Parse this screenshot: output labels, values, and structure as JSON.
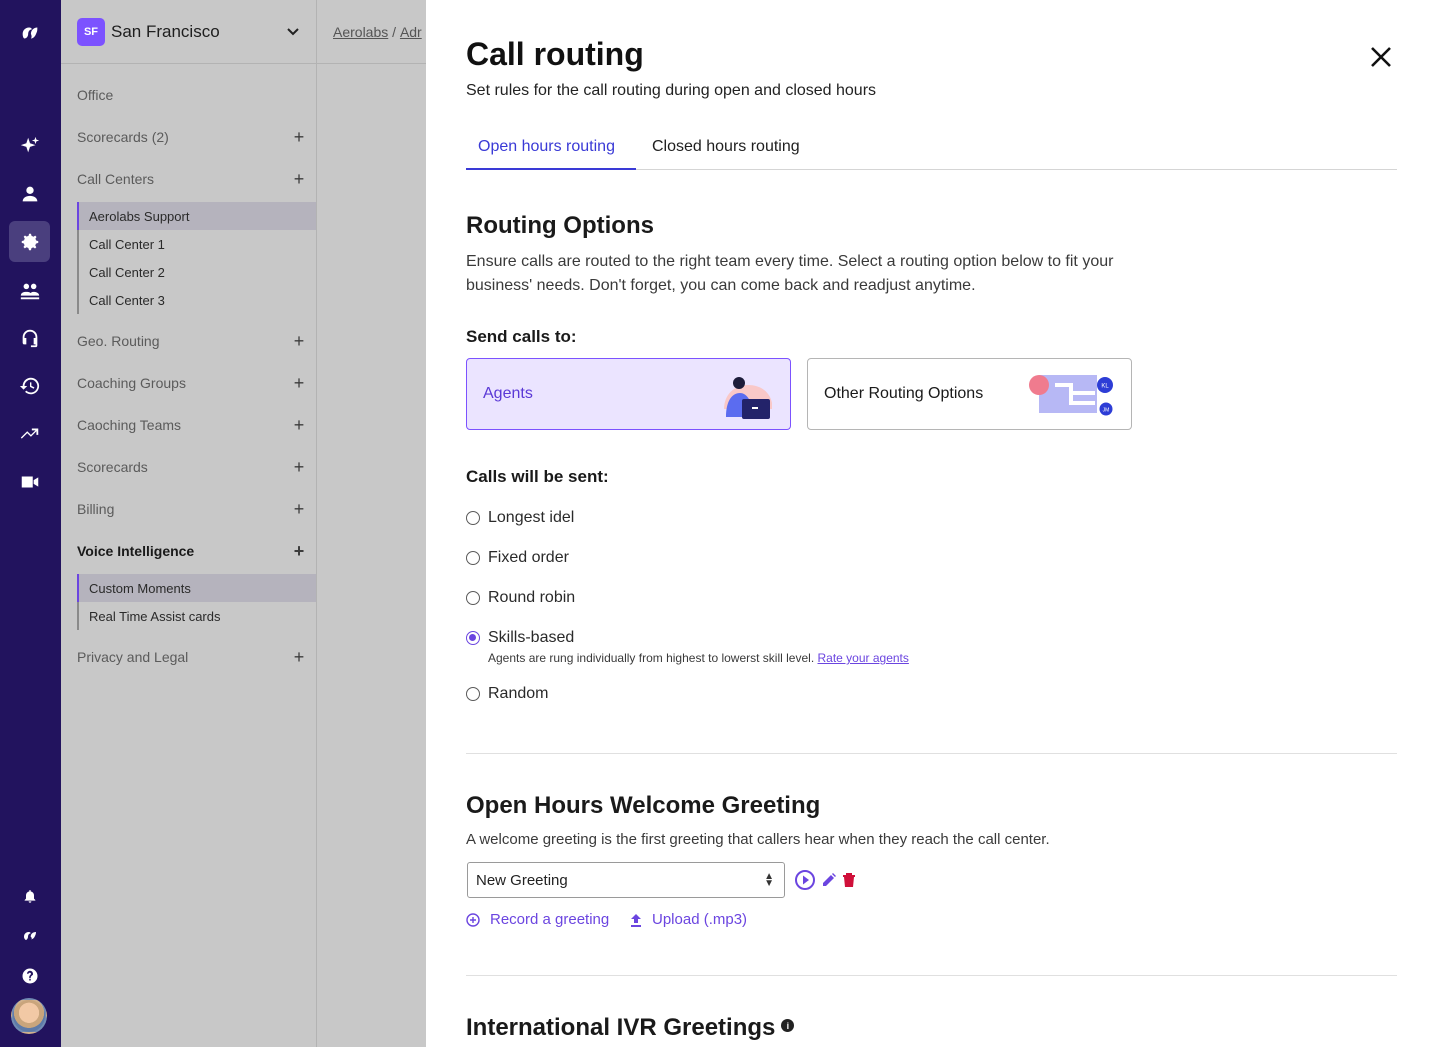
{
  "sidebar": {
    "location_badge": "SF",
    "location_name": "San Francisco",
    "items": [
      {
        "label": "Office"
      },
      {
        "label": "Scorecards (2)",
        "plus": "+"
      },
      {
        "label": "Call Centers",
        "plus": "+"
      },
      {
        "label": "Geo. Routing",
        "plus": "+"
      },
      {
        "label": "Coaching Groups",
        "plus": "+"
      },
      {
        "label": "Caoching Teams",
        "plus": "+"
      },
      {
        "label": "Scorecards",
        "plus": "+"
      },
      {
        "label": "Billing",
        "plus": "+"
      },
      {
        "label": "Voice Intelligence",
        "plus": "+"
      },
      {
        "label": "Privacy and Legal",
        "plus": "+"
      }
    ],
    "call_centers": [
      "Aerolabs Support",
      "Call Center 1",
      "Call Center 2",
      "Call Center 3"
    ],
    "voice_intelligence": [
      "Custom Moments",
      "Real Time Assist cards"
    ]
  },
  "breadcrumb": {
    "part1": "Aerolabs",
    "sep": " / ",
    "part2": "Adr"
  },
  "panel": {
    "title": "Call routing",
    "subtitle": "Set rules for the call routing during open and closed hours",
    "tabs": [
      "Open hours routing",
      "Closed hours routing"
    ],
    "active_tab": "Open hours routing",
    "routing": {
      "heading": "Routing Options",
      "description": "Ensure calls are routed to the right team every time. Select a routing option below to fit your business' needs. Don't forget, you can come back and readjust anytime.",
      "send_label": "Send calls to:",
      "cards": [
        {
          "label": "Agents",
          "selected": true
        },
        {
          "label": "Other Routing Options",
          "selected": false,
          "badge1": "KL",
          "badge2": "JM"
        }
      ],
      "sent_label": "Calls will be sent:",
      "options": [
        "Longest idel",
        "Fixed order",
        "Round robin",
        "Skills-based",
        "Random"
      ],
      "selected_option": "Skills-based",
      "skills_hint": "Agents are rung individually from highest to lowerst skill level.",
      "skills_link": "Rate your agents"
    },
    "greeting": {
      "heading": "Open Hours Welcome Greeting",
      "description": "A welcome greeting is the first greeting that callers hear when they reach the call center.",
      "select_value": "New Greeting",
      "record_label": "Record a greeting",
      "upload_label": "Upload (.mp3)"
    },
    "ivr": {
      "heading": "International IVR Greetings",
      "info": "i"
    }
  },
  "colors": {
    "rail": "#22135e",
    "accent": "#6b45e0",
    "tab_active": "#3a3ad6",
    "danger": "#d0103a"
  }
}
